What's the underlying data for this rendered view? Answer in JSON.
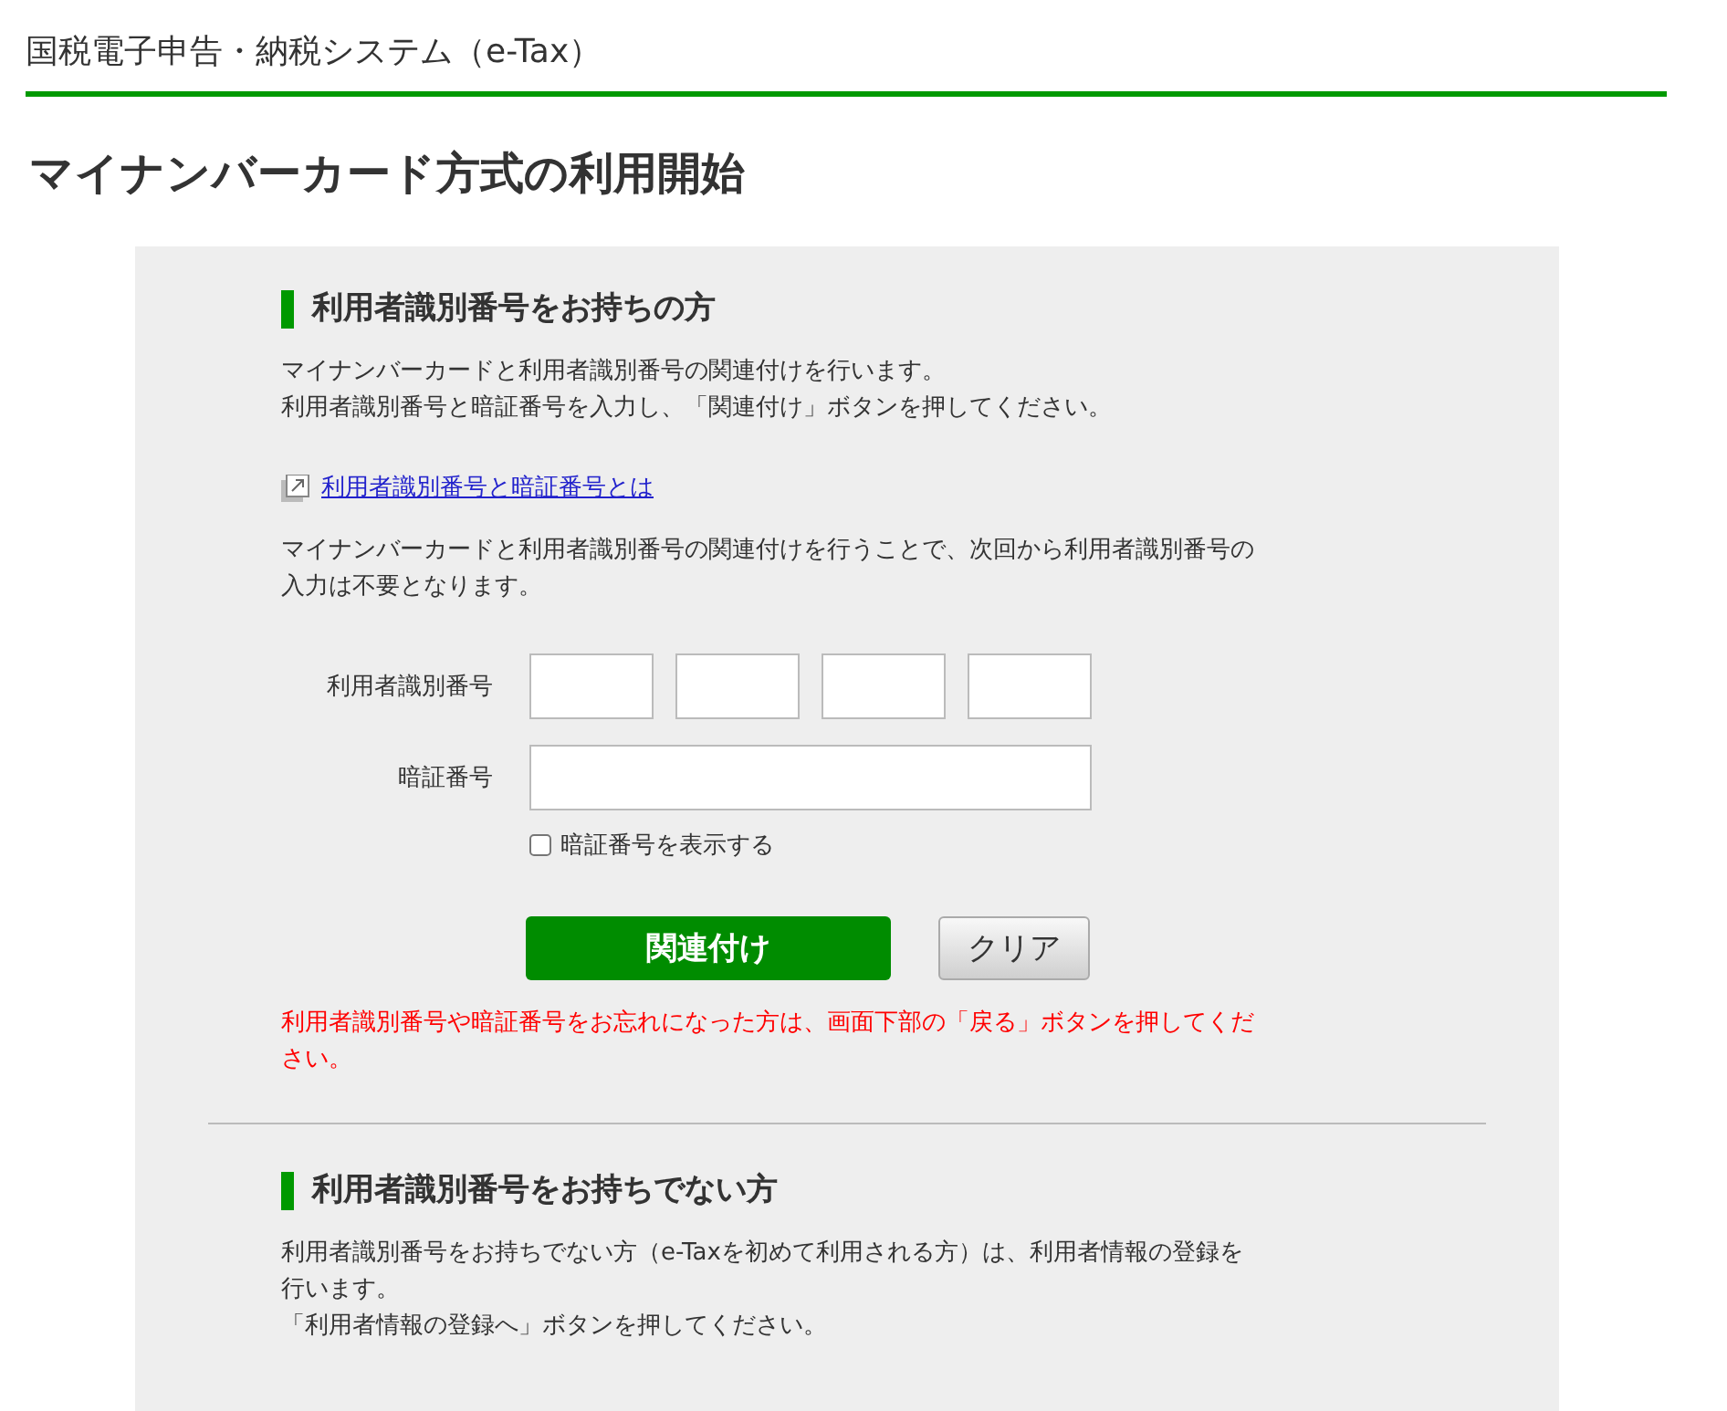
{
  "header": {
    "title": "国税電子申告・納税システム（e-Tax）"
  },
  "page_title": "マイナンバーカード方式の利用開始",
  "section_with_id": {
    "heading": "利用者識別番号をお持ちの方",
    "intro_lines": [
      "マイナンバーカードと利用者識別番号の関連付けを行います。",
      "利用者識別番号と暗証番号を入力し、「関連付け」ボタンを押してください。"
    ],
    "link": "利用者識別番号と暗証番号とは",
    "note_lines": [
      "マイナンバーカードと利用者識別番号の関連付けを行うことで、次回から利用者識別番号の",
      "入力は不要となります。"
    ],
    "id_label": "利用者識別番号",
    "pin_label": "暗証番号",
    "show_pin": {
      "label": "暗証番号を表示する",
      "checked": false
    },
    "buttons": [
      {
        "kind": "primary",
        "label": "関連付け"
      },
      {
        "kind": "secondary",
        "label": "クリア"
      }
    ],
    "warning_lines": [
      "利用者識別番号や暗証番号をお忘れになった方は、画面下部の「戻る」ボタンを押してくだ",
      "さい。"
    ]
  },
  "section_without_id": {
    "heading": "利用者識別番号をお持ちでない方",
    "body_lines": [
      "利用者識別番号をお持ちでない方（e-Taxを初めて利用される方）は、利用者情報の登録を",
      "行います。",
      "「利用者情報の登録へ」ボタンを押してください。"
    ]
  }
}
